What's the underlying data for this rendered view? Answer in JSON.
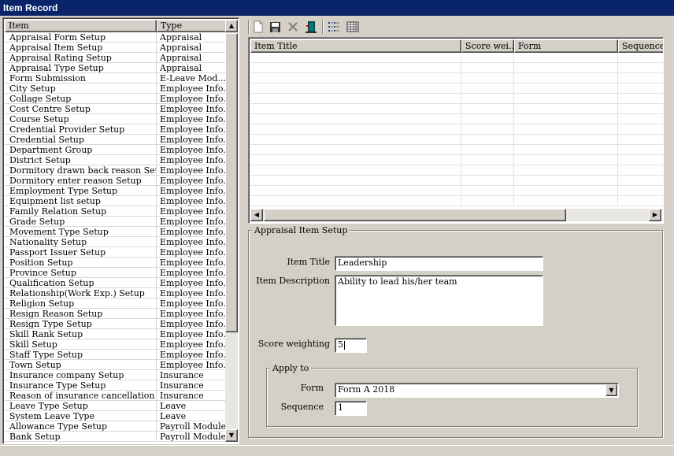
{
  "window": {
    "title": "Item Record"
  },
  "list": {
    "columns": [
      "Item",
      "Type"
    ],
    "rows": [
      [
        "Appraisal Form Setup",
        "Appraisal"
      ],
      [
        "Appraisal Item Setup",
        "Appraisal"
      ],
      [
        "Appraisal Rating Setup",
        "Appraisal"
      ],
      [
        "Appraisal Type Setup",
        "Appraisal"
      ],
      [
        "Form Submission",
        "E-Leave Mod..."
      ],
      [
        "City Setup",
        "Employee Info."
      ],
      [
        "Collage Setup",
        "Employee Info."
      ],
      [
        "Cost Centre Setup",
        "Employee Info."
      ],
      [
        "Course Setup",
        "Employee Info."
      ],
      [
        "Credential Provider Setup",
        "Employee Info."
      ],
      [
        "Credential Setup",
        "Employee Info."
      ],
      [
        "Department Group",
        "Employee Info."
      ],
      [
        "District Setup",
        "Employee Info."
      ],
      [
        "Dormitory drawn back reason Setup",
        "Employee Info."
      ],
      [
        "Dormitory enter reason Setup",
        "Employee Info."
      ],
      [
        "Employment Type Setup",
        "Employee Info."
      ],
      [
        "Equipment list setup",
        "Employee Info."
      ],
      [
        "Family Relation Setup",
        "Employee Info."
      ],
      [
        "Grade Setup",
        "Employee Info."
      ],
      [
        "Movement Type Setup",
        "Employee Info."
      ],
      [
        "Nationality Setup",
        "Employee Info."
      ],
      [
        "Passport Issuer Setup",
        "Employee Info."
      ],
      [
        "Position Setup",
        "Employee Info."
      ],
      [
        "Province Setup",
        "Employee Info."
      ],
      [
        "Qualification Setup",
        "Employee Info."
      ],
      [
        "Relationship(Work Exp.) Setup",
        "Employee Info."
      ],
      [
        "Religion Setup",
        "Employee Info."
      ],
      [
        "Resign Reason Setup",
        "Employee Info."
      ],
      [
        "Resign Type Setup",
        "Employee Info."
      ],
      [
        "Skill Rank Setup",
        "Employee Info."
      ],
      [
        "Skill Setup",
        "Employee Info."
      ],
      [
        "Staff Type Setup",
        "Employee Info."
      ],
      [
        "Town Setup",
        "Employee Info."
      ],
      [
        "Insurance company Setup",
        "Insurance"
      ],
      [
        "Insurance Type Setup",
        "Insurance"
      ],
      [
        "Reason of insurance cancellation Setup",
        "Insurance"
      ],
      [
        "Leave Type Setup",
        "Leave"
      ],
      [
        "System Leave Type",
        "Leave"
      ],
      [
        "Allowance Type Setup",
        "Payroll Module"
      ],
      [
        "Bank Setup",
        "Payroll Module"
      ]
    ]
  },
  "toolbar": {
    "buttons": [
      "new-icon",
      "save-icon",
      "delete-icon",
      "exit-icon",
      "list-view-icon",
      "grid-view-icon"
    ]
  },
  "grid": {
    "columns": [
      "Item Title",
      "Score wei...",
      "Form",
      "Sequence"
    ]
  },
  "form": {
    "group_title": "Appraisal Item Setup",
    "item_title_label": "Item Title",
    "item_title_value": "Leadership",
    "item_desc_label": "Item Description",
    "item_desc_value": "Ability to lead his/her team",
    "score_label": "Score weighting",
    "score_value": "5",
    "apply_to": {
      "group_title": "Apply to",
      "form_label": "Form",
      "form_value": "Form A 2018",
      "sequence_label": "Sequence",
      "sequence_value": "1"
    }
  }
}
